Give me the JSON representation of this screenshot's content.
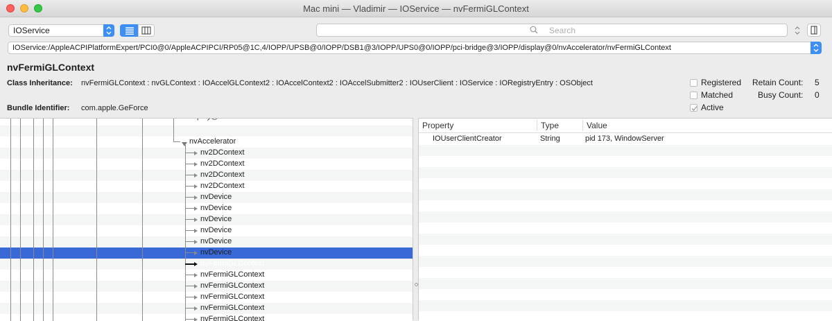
{
  "window": {
    "title": "Mac mini — Vladimir — IOService — nvFermiGLContext"
  },
  "toolbar": {
    "plane_select": "IOService",
    "search_placeholder": "Search"
  },
  "path_bar": {
    "path": "IOService:/AppleACPIPlatformExpert/PCI0@0/AppleACPIPCI/RP05@1C,4/IOPP/UPSB@0/IOPP/DSB1@3/IOPP/UPS0@0/IOPP/pci-bridge@3/IOPP/display@0/nvAccelerator/nvFermiGLContext"
  },
  "details": {
    "name": "nvFermiGLContext",
    "class_inheritance_label": "Class Inheritance:",
    "class_inheritance": "nvFermiGLContext : nvGLContext : IOAccelGLContext2 : IOAccelContext2 : IOAccelSubmitter2 : IOUserClient : IOService : IORegistryEntry : OSObject",
    "bundle_identifier_label": "Bundle Identifier:",
    "bundle_identifier": "com.apple.GeForce",
    "registered_label": "Registered",
    "registered": false,
    "matched_label": "Matched",
    "matched": false,
    "active_label": "Active",
    "active": true,
    "retain_count_label": "Retain Count:",
    "retain_count": "5",
    "busy_count_label": "Busy Count:",
    "busy_count": "0"
  },
  "tree": {
    "partial_top": "display@0",
    "parent": "nvAccelerator",
    "children": [
      "nv2DContext",
      "nv2DContext",
      "nv2DContext",
      "nv2DContext",
      "nvDevice",
      "nvDevice",
      "nvDevice",
      "nvDevice",
      "nvDevice",
      "nvDevice",
      "nvFermiGLContext",
      "nvFermiGLContext",
      "nvFermiGLContext",
      "nvFermiGLContext",
      "nvFermiGLContext",
      "nvFermiGLContext"
    ],
    "selected_index": 10
  },
  "properties": {
    "headers": {
      "property": "Property",
      "type": "Type",
      "value": "Value"
    },
    "rows": [
      {
        "property": "IOUserClientCreator",
        "type": "String",
        "value": "pid 173, WindowServer"
      }
    ]
  },
  "colors": {
    "selection": "#3969d6",
    "accent": "#3d8ff5"
  }
}
